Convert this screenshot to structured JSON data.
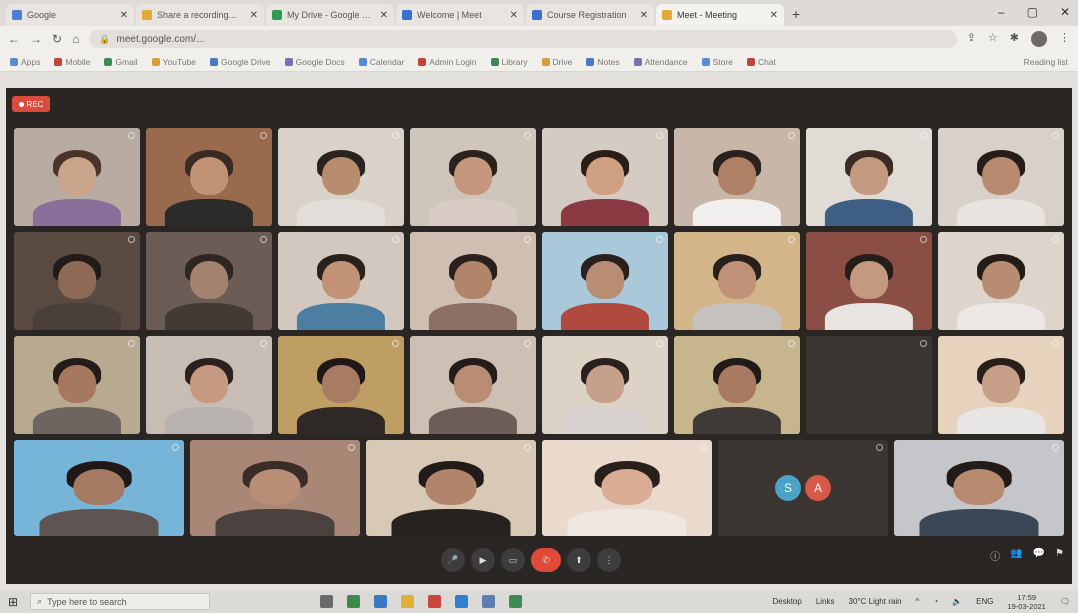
{
  "browser": {
    "tabs": [
      {
        "title": "Google",
        "color": "#4a7fd1"
      },
      {
        "title": "Share a recording...",
        "color": "#e0a93a"
      },
      {
        "title": "My Drive - Google Driv",
        "color": "#2f9a58"
      },
      {
        "title": "Welcome | Meet",
        "color": "#3b6fd0"
      },
      {
        "title": "Course Registration",
        "color": "#3b6fd0"
      },
      {
        "title": "Meet - Meeting",
        "color": "#e0a93a"
      }
    ],
    "active_tab": 5,
    "new_tab_label": "+",
    "url": "meet.google.com/...",
    "window_controls": [
      "–",
      "▢",
      "✕"
    ]
  },
  "bookmarks": {
    "items": [
      "Apps",
      "Mobile",
      "Gmail",
      "YouTube",
      "Google Drive",
      "Google Docs",
      "Calendar",
      "Admin Login",
      "Library",
      "Drive",
      "Notes",
      "Attendance",
      "Store",
      "Chat"
    ],
    "right_label": "Reading list"
  },
  "meeting": {
    "rec_label": "REC",
    "participants": [
      {
        "name": "",
        "skin": "#c9a58c",
        "hair": "#4a3328",
        "shirt": "#8a6f9a",
        "bg": "#b7aba2"
      },
      {
        "name": "",
        "skin": "#c29276",
        "hair": "#3a2a22",
        "shirt": "#2b2b2b",
        "bg": "#9a6a4e"
      },
      {
        "name": "",
        "skin": "#b88c6f",
        "hair": "#2a2320",
        "shirt": "#e1ddd8",
        "bg": "#d9d2c9"
      },
      {
        "name": "",
        "skin": "#c4977c",
        "hair": "#2c211d",
        "shirt": "#d9ccc4",
        "bg": "#cfc5bb"
      },
      {
        "name": "",
        "skin": "#d0a084",
        "hair": "#2b1e19",
        "shirt": "#8a3a42",
        "bg": "#d6cbc2"
      },
      {
        "name": "",
        "skin": "#b08066",
        "hair": "#2b211e",
        "shirt": "#f1efee",
        "bg": "#c8b7a8"
      },
      {
        "name": "",
        "skin": "#c39a80",
        "hair": "#3b2b24",
        "shirt": "#3f5e86",
        "bg": "#e0dbd4"
      },
      {
        "name": "",
        "skin": "#b88a70",
        "hair": "#261d1a",
        "shirt": "#e6e3e1",
        "bg": "#d8d1ca"
      },
      {
        "name": "",
        "skin": "#8c6a55",
        "hair": "#231b18",
        "shirt": "#4a3f3a",
        "bg": "#5a4b42"
      },
      {
        "name": "",
        "skin": "#a3836f",
        "hair": "#2e2622",
        "shirt": "#433a35",
        "bg": "#6b5d55"
      },
      {
        "name": "",
        "skin": "#c29276",
        "hair": "#2b211c",
        "shirt": "#4b7ea0",
        "bg": "#d3c8c0"
      },
      {
        "name": "",
        "skin": "#b28469",
        "hair": "#2a211d",
        "shirt": "#8c7066",
        "bg": "#cfbfb2"
      },
      {
        "name": "",
        "skin": "#b98d74",
        "hair": "#2a201c",
        "shirt": "#b04a3e",
        "bg": "#a9c9da"
      },
      {
        "name": "",
        "skin": "#c09077",
        "hair": "#2a201b",
        "shirt": "#c5c1bf",
        "bg": "#d3b58a"
      },
      {
        "name": "",
        "skin": "#c39a80",
        "hair": "#261d19",
        "shirt": "#e8e4e2",
        "bg": "#8a4e44"
      },
      {
        "name": "",
        "skin": "#b78c72",
        "hair": "#241c18",
        "shirt": "#ebe7e4",
        "bg": "#ddd5cc"
      },
      {
        "name": "",
        "skin": "#a6785f",
        "hair": "#241c18",
        "shirt": "#6e6561",
        "bg": "#b8a990"
      },
      {
        "name": "",
        "skin": "#c59a80",
        "hair": "#2c211c",
        "shirt": "#b8b3b0",
        "bg": "#c7bdb5"
      },
      {
        "name": "",
        "skin": "#a87c62",
        "hair": "#201816",
        "shirt": "#2e2926",
        "bg": "#bf9e63"
      },
      {
        "name": "",
        "skin": "#b88d73",
        "hair": "#241c18",
        "shirt": "#6d5d57",
        "bg": "#cdbfb4"
      },
      {
        "name": "",
        "skin": "#c6a08a",
        "hair": "#2b211c",
        "shirt": "#d8d3d0",
        "bg": "#ddd2c6"
      },
      {
        "name": "",
        "skin": "#a77a61",
        "hair": "#221a17",
        "shirt": "#3f3a37",
        "bg": "#c7b58e"
      },
      {
        "name": "",
        "skin": "#3b3532",
        "hair": "#3b3532",
        "shirt": "#3b3532",
        "bg": "#3b3532"
      },
      {
        "name": "",
        "skin": "#c8a089",
        "hair": "#2a201b",
        "shirt": "#e8e6e4",
        "bg": "#e6d2bd"
      },
      {
        "name": "",
        "skin": "#a47a62",
        "hair": "#201816",
        "shirt": "#5c5552",
        "bg": "#77b5d8"
      },
      {
        "name": "",
        "skin": "#b88f76",
        "hair": "#3a2d27",
        "shirt": "#4b423f",
        "bg": "#a98776"
      },
      {
        "name": "",
        "skin": "#b0856c",
        "hair": "#231b18",
        "shirt": "#262220",
        "bg": "#d8c9b6"
      },
      {
        "name": "",
        "skin": "#d8ad94",
        "hair": "#2a201b",
        "shirt": "#efe7e2",
        "bg": "#ead9cd"
      },
      {
        "name": "",
        "skin": "#3b3532",
        "hair": "#3b3532",
        "shirt": "#3b3532",
        "bg": "#3b3532"
      },
      {
        "name": "",
        "skin": "#b88a70",
        "hair": "#231b18",
        "shirt": "#3a4757",
        "bg": "#c4c6c9"
      }
    ],
    "avatar_letters": [
      {
        "letter": "S",
        "color": "#4aa3c7"
      },
      {
        "letter": "A",
        "color": "#d65a4a"
      }
    ],
    "meeting_code": "",
    "controls": [
      {
        "name": "mic-button",
        "glyph": "🎤"
      },
      {
        "name": "camera-button",
        "glyph": "▶"
      },
      {
        "name": "captions-button",
        "glyph": "▭"
      },
      {
        "name": "present-button",
        "glyph": "⬆"
      },
      {
        "name": "more-button",
        "glyph": "⋮"
      }
    ],
    "end_call_glyph": "✆",
    "side_buttons": [
      "ⓘ",
      "👥",
      "💬",
      "⚑"
    ]
  },
  "taskbar": {
    "search_placeholder": "Type here to search",
    "desktop_label": "Desktop",
    "links_label": "Links",
    "weather": "30°C Light rain",
    "language": "ENG",
    "time": "17:59",
    "date": "19-03-2021"
  }
}
